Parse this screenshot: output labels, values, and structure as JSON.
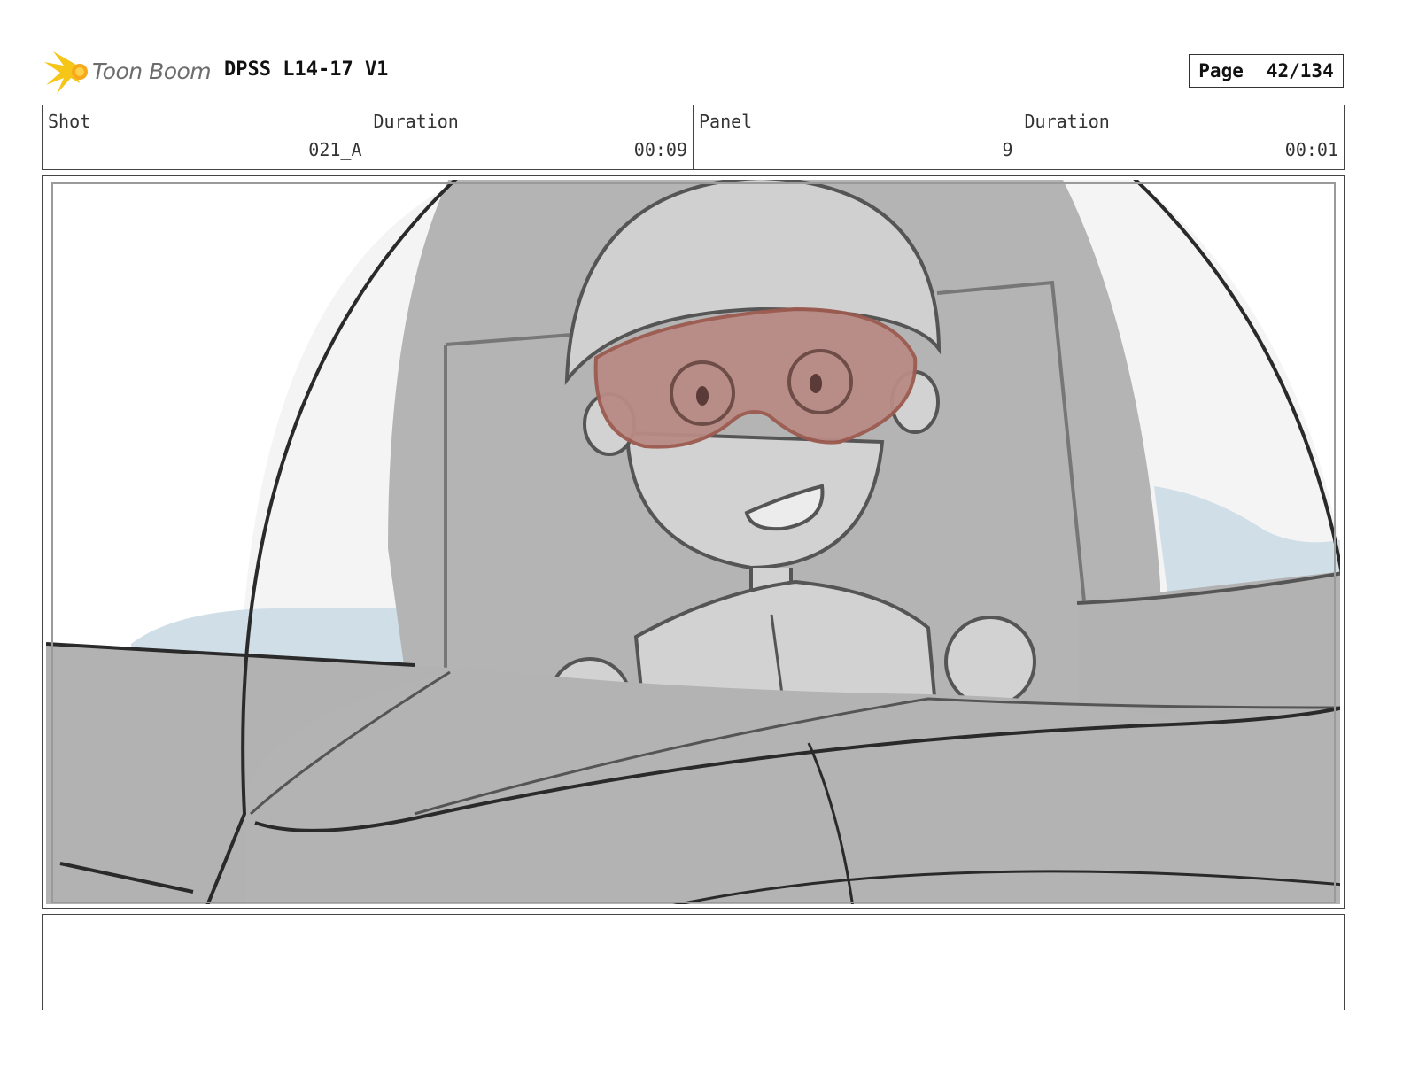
{
  "header": {
    "logo_text": "Toon Boom",
    "title": "DPSS L14-17 V1",
    "page_label": "Page",
    "page_value": "42/134"
  },
  "info": {
    "shot_label": "Shot",
    "shot_value": "021_A",
    "shot_duration_label": "Duration",
    "shot_duration_value": "00:09",
    "panel_label": "Panel",
    "panel_value": "9",
    "panel_duration_label": "Duration",
    "panel_duration_value": "00:01"
  },
  "colors": {
    "logo_accent": "#f5c518",
    "goggles": "#b98b85",
    "sky_blue": "#cfdee7"
  },
  "notes": ""
}
